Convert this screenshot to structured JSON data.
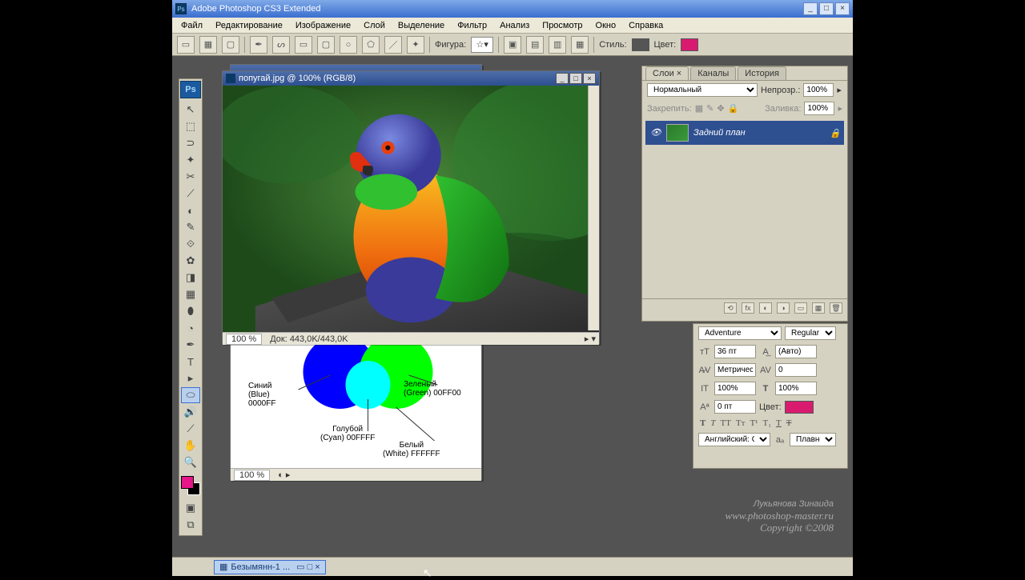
{
  "app": {
    "title": "Adobe Photoshop CS3 Extended"
  },
  "menu": [
    "Файл",
    "Редактирование",
    "Изображение",
    "Слой",
    "Выделение",
    "Фильтр",
    "Анализ",
    "Просмотр",
    "Окно",
    "Справка"
  ],
  "options": {
    "shape_label": "Фигура:",
    "style_label": "Стиль:",
    "color_label": "Цвет:",
    "color_value": "#d81b6f",
    "style_swatch": "#555555"
  },
  "doc_parrot": {
    "title": "попугай.jpg @ 100% (RGB/8)",
    "zoom": "100 %",
    "status": "Док: 443,0K/443,0K"
  },
  "doc_colors": {
    "zoom": "100 %",
    "labels": {
      "blue": "Синий\n(Blue)\n0000FF",
      "green": "Зеленый\n(Green) 00FF00",
      "cyan": "Голубой\n(Cyan) 00FFFF",
      "white": "Белый\n(White) FFFFFF"
    }
  },
  "layers_panel": {
    "tabs": [
      "Слои ×",
      "Каналы",
      "История"
    ],
    "blend_mode": "Нормальный",
    "opacity_label": "Непрозр.:",
    "opacity": "100%",
    "lock_label": "Закрепить:",
    "fill_label": "Заливка:",
    "fill": "100%",
    "layer_name": "Задний план"
  },
  "char_panel": {
    "font": "Adventure",
    "style": "Regular",
    "size": "36 пт",
    "leading": "(Авто)",
    "kerning": "Метричес",
    "tracking": "0",
    "vscale": "100%",
    "hscale": "100%",
    "baseline": "0 пт",
    "color_label": "Цвет:",
    "color": "#d81b6f",
    "lang": "Английский: С...",
    "aa": "Плавное"
  },
  "taskbar": {
    "doc": "Безымянн-1 ..."
  },
  "watermark": {
    "l1": "Лукьянова Зинаида",
    "l2": "www.photoshop-master.ru",
    "l3": "Copyright ©2008"
  },
  "tools": [
    "↖",
    "⬚",
    "⊃",
    "✦",
    "□",
    "✂",
    "◐",
    "✎",
    "⟋",
    "✿",
    "◔",
    "⟋",
    "⬥",
    "△",
    "T",
    "▸",
    "⬭",
    "🔊",
    "⟋",
    "✋",
    "🔍"
  ]
}
